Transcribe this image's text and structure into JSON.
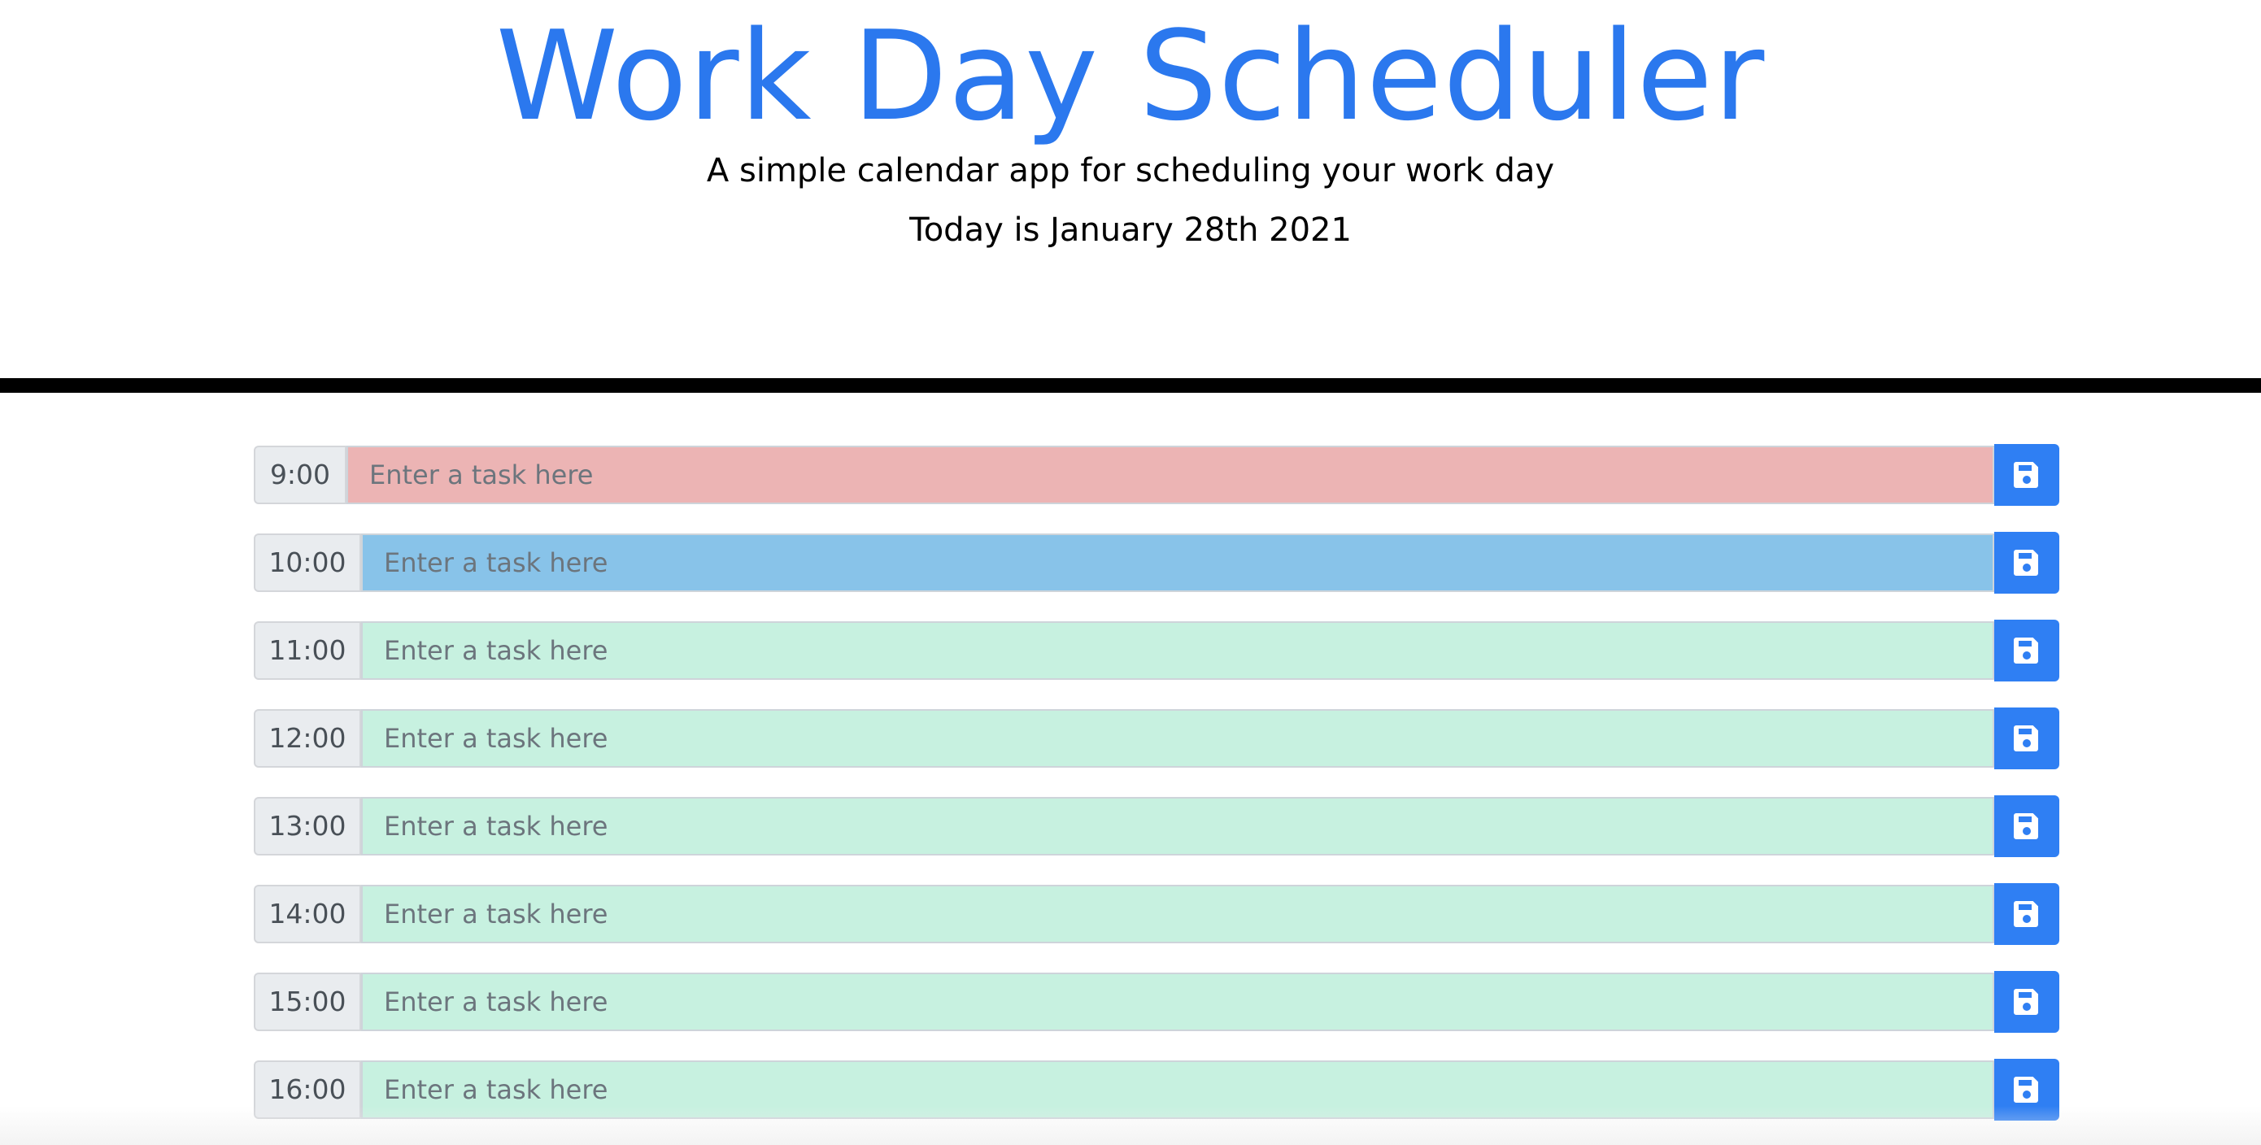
{
  "header": {
    "title": "Work Day Scheduler",
    "subtitle": "A simple calendar app for scheduling your work day",
    "date_text": "Today is January 28th 2021"
  },
  "colors": {
    "title": "#2b78ee",
    "divider": "#000000",
    "past": "#ecb4b4",
    "present": "#88c3e9",
    "future": "#c7f1e0",
    "save_button": "#2f7ff3",
    "save_icon": "#ffffff"
  },
  "schedule": {
    "rows": [
      {
        "hour": "9:00",
        "state": "past",
        "value": "",
        "placeholder": "Enter a task here",
        "icon": "floppy-disk-icon"
      },
      {
        "hour": "10:00",
        "state": "present",
        "value": "",
        "placeholder": "Enter a task here",
        "icon": "floppy-disk-icon"
      },
      {
        "hour": "11:00",
        "state": "future",
        "value": "",
        "placeholder": "Enter a task here",
        "icon": "floppy-disk-icon"
      },
      {
        "hour": "12:00",
        "state": "future",
        "value": "",
        "placeholder": "Enter a task here",
        "icon": "floppy-disk-icon"
      },
      {
        "hour": "13:00",
        "state": "future",
        "value": "",
        "placeholder": "Enter a task here",
        "icon": "floppy-disk-icon"
      },
      {
        "hour": "14:00",
        "state": "future",
        "value": "",
        "placeholder": "Enter a task here",
        "icon": "floppy-disk-icon"
      },
      {
        "hour": "15:00",
        "state": "future",
        "value": "",
        "placeholder": "Enter a task here",
        "icon": "floppy-disk-icon"
      },
      {
        "hour": "16:00",
        "state": "future",
        "value": "",
        "placeholder": "Enter a task here",
        "icon": "floppy-disk-icon"
      }
    ]
  }
}
